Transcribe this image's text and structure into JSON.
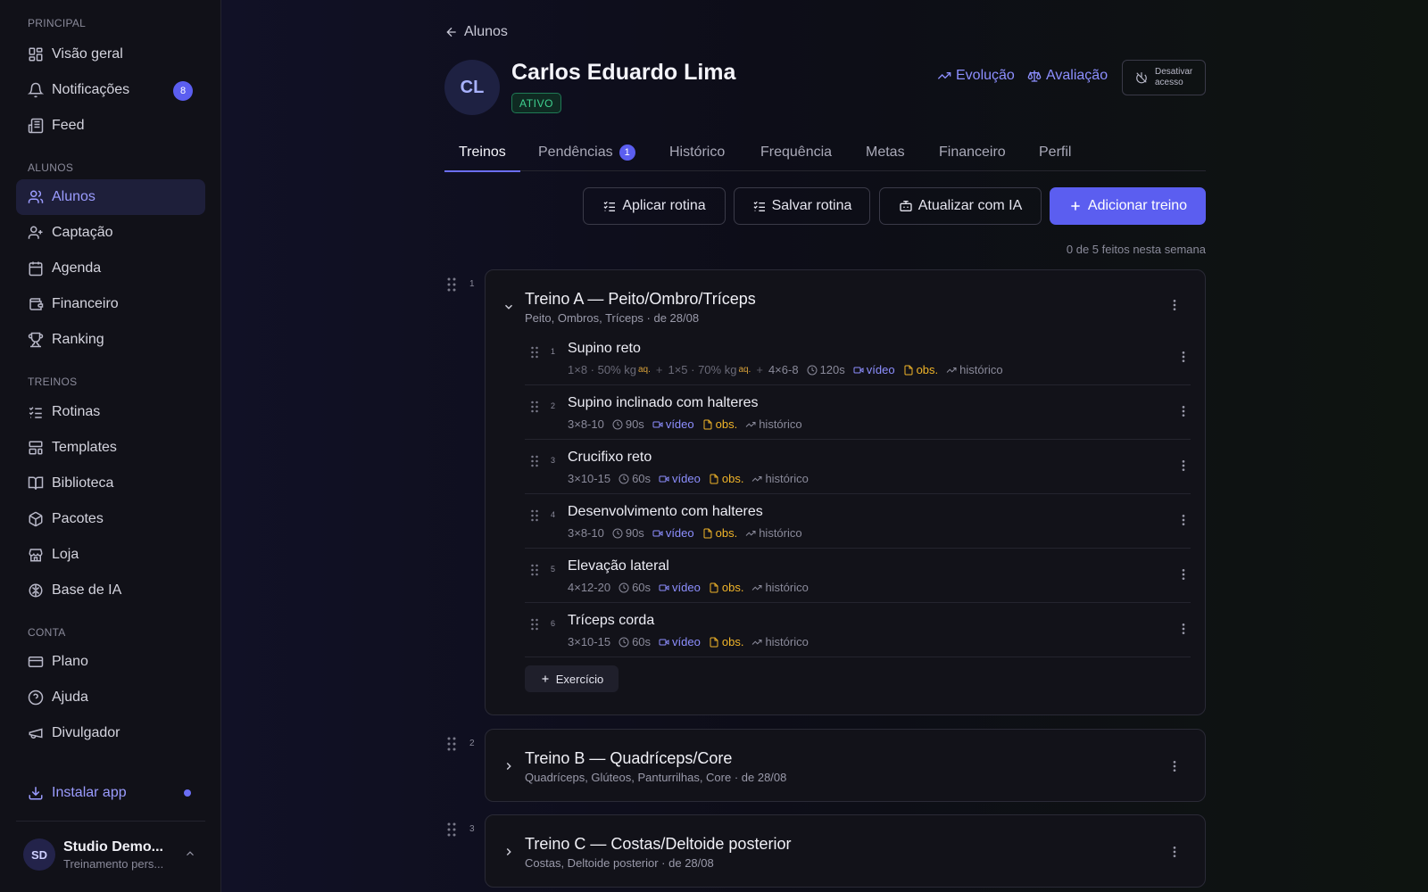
{
  "sidebar": {
    "sections": {
      "principal": "PRINCIPAL",
      "alunos": "ALUNOS",
      "treinos": "TREINOS",
      "conta": "CONTA"
    },
    "items": [
      {
        "label": "Visão geral"
      },
      {
        "label": "Notificações",
        "badge": "8"
      },
      {
        "label": "Feed"
      },
      {
        "label": "Alunos"
      },
      {
        "label": "Captação"
      },
      {
        "label": "Agenda"
      },
      {
        "label": "Financeiro"
      },
      {
        "label": "Ranking"
      },
      {
        "label": "Rotinas"
      },
      {
        "label": "Templates"
      },
      {
        "label": "Biblioteca"
      },
      {
        "label": "Pacotes"
      },
      {
        "label": "Loja"
      },
      {
        "label": "Base de IA"
      },
      {
        "label": "Plano"
      },
      {
        "label": "Ajuda"
      },
      {
        "label": "Divulgador"
      }
    ],
    "install_label": "Instalar app",
    "user": {
      "initials": "SD",
      "name": "Studio Demo...",
      "subtitle": "Treinamento pers..."
    }
  },
  "header": {
    "back_label": "Alunos",
    "avatar_initials": "CL",
    "student_name": "Carlos Eduardo Lima",
    "status": "ATIVO",
    "evolution_label": "Evolução",
    "assessment_label": "Avaliação",
    "deactivate_line1": "Desativar",
    "deactivate_line2": "acesso"
  },
  "tabs": [
    {
      "label": "Treinos",
      "active": true
    },
    {
      "label": "Pendências",
      "badge": "1"
    },
    {
      "label": "Histórico"
    },
    {
      "label": "Frequência"
    },
    {
      "label": "Metas"
    },
    {
      "label": "Financeiro"
    },
    {
      "label": "Perfil"
    }
  ],
  "actions": {
    "apply_routine": "Aplicar rotina",
    "save_routine": "Salvar rotina",
    "update_ai": "Atualizar com IA",
    "add_workout": "Adicionar treino"
  },
  "weekly_status": "0 de 5 feitos nesta semana",
  "workouts": [
    {
      "index": "1",
      "title": "Treino A — Peito/Ombro/Tríceps",
      "subtitle": "Peito, Ombros, Tríceps · de 28/08",
      "expanded": true,
      "exercises": [
        {
          "index": "1",
          "name": "Supino reto",
          "warmup1": "1×8 · 50% kg",
          "warmup2": "1×5 · 70% kg",
          "aq": "aq.",
          "sets": "4×6-8",
          "rest": "120s",
          "video": "vídeo",
          "obs": "obs.",
          "history": "histórico"
        },
        {
          "index": "2",
          "name": "Supino inclinado com halteres",
          "sets": "3×8-10",
          "rest": "90s",
          "video": "vídeo",
          "obs": "obs.",
          "history": "histórico"
        },
        {
          "index": "3",
          "name": "Crucifixo reto",
          "sets": "3×10-15",
          "rest": "60s",
          "video": "vídeo",
          "obs": "obs.",
          "history": "histórico"
        },
        {
          "index": "4",
          "name": "Desenvolvimento com halteres",
          "sets": "3×8-10",
          "rest": "90s",
          "video": "vídeo",
          "obs": "obs.",
          "history": "histórico"
        },
        {
          "index": "5",
          "name": "Elevação lateral",
          "sets": "4×12-20",
          "rest": "60s",
          "video": "vídeo",
          "obs": "obs.",
          "history": "histórico"
        },
        {
          "index": "6",
          "name": "Tríceps corda",
          "sets": "3×10-15",
          "rest": "60s",
          "video": "vídeo",
          "obs": "obs.",
          "history": "histórico"
        }
      ],
      "add_exercise_label": "Exercício"
    },
    {
      "index": "2",
      "title": "Treino B — Quadríceps/Core",
      "subtitle": "Quadríceps, Glúteos, Panturrilhas, Core · de 28/08",
      "expanded": false
    },
    {
      "index": "3",
      "title": "Treino C — Costas/Deltoide posterior",
      "subtitle": "Costas, Deltoide posterior · de 28/08",
      "expanded": false
    }
  ],
  "colors": {
    "accent": "#5b5ef0",
    "accent_text": "#8d8fff",
    "active_status": "#3fd08f",
    "obs": "#f0b429"
  }
}
